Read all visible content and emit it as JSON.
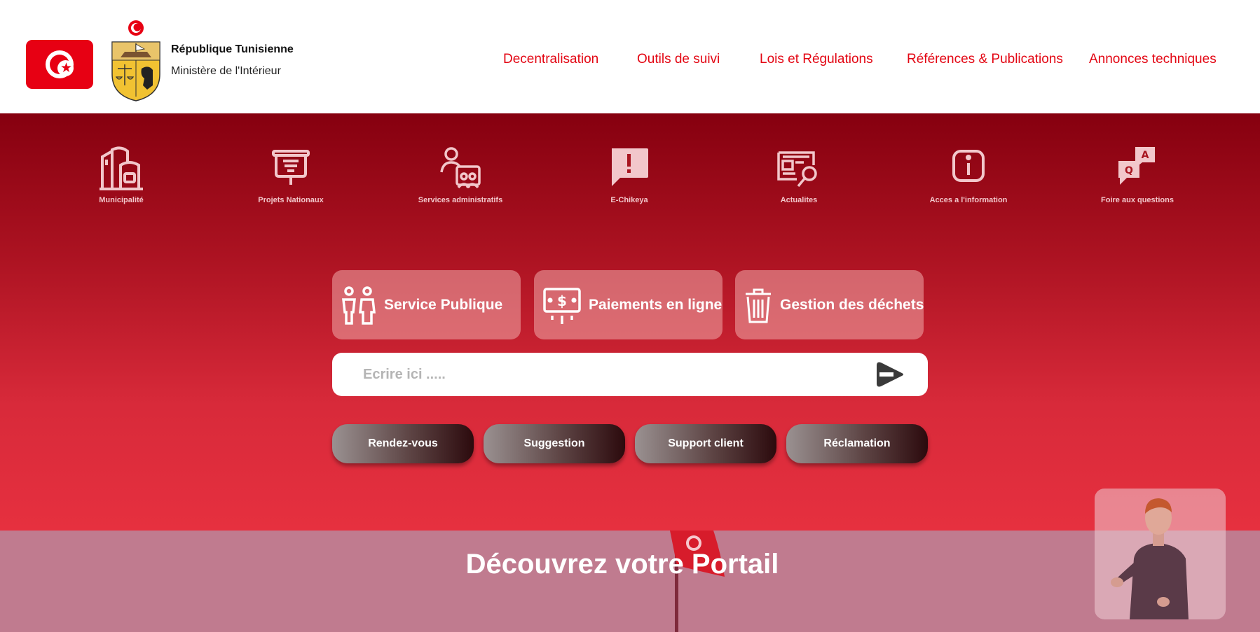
{
  "header": {
    "republic_label": "République Tunisienne",
    "ministry_label": "Ministère de l'Intérieur",
    "nav": [
      {
        "label": "Decentralisation"
      },
      {
        "label": "Outils de suivi"
      },
      {
        "label": "Lois et Régulations"
      },
      {
        "label": "Références & Publications"
      },
      {
        "label": "Annonces techniques"
      }
    ]
  },
  "quick_links": [
    {
      "label": "Municipalité",
      "icon": "municipality-icon"
    },
    {
      "label": "Projets Nationaux",
      "icon": "projector-icon"
    },
    {
      "label": "Services administratifs",
      "icon": "admin-services-icon"
    },
    {
      "label": "E-Chikeya",
      "icon": "complaint-icon"
    },
    {
      "label": "Actualites",
      "icon": "news-icon"
    },
    {
      "label": "Acces a l'information",
      "icon": "info-icon"
    },
    {
      "label": "Foire aux questions",
      "icon": "faq-icon"
    }
  ],
  "services": [
    {
      "label": "Service Publique",
      "icon": "people-icon"
    },
    {
      "label": "Paiements en ligne",
      "icon": "payment-icon"
    },
    {
      "label": "Gestion des déchets",
      "icon": "trash-icon"
    }
  ],
  "search": {
    "placeholder": "Ecrire ici ....."
  },
  "actions": [
    {
      "label": "Rendez-vous"
    },
    {
      "label": "Suggestion"
    },
    {
      "label": "Support client"
    },
    {
      "label": "Réclamation"
    }
  ],
  "discover": {
    "title": "Découvrez votre Portail"
  },
  "colors": {
    "brand_red": "#e30613",
    "flag_red": "#e70013",
    "hero_top": "#86000f",
    "hero_bottom": "#e6303f"
  }
}
